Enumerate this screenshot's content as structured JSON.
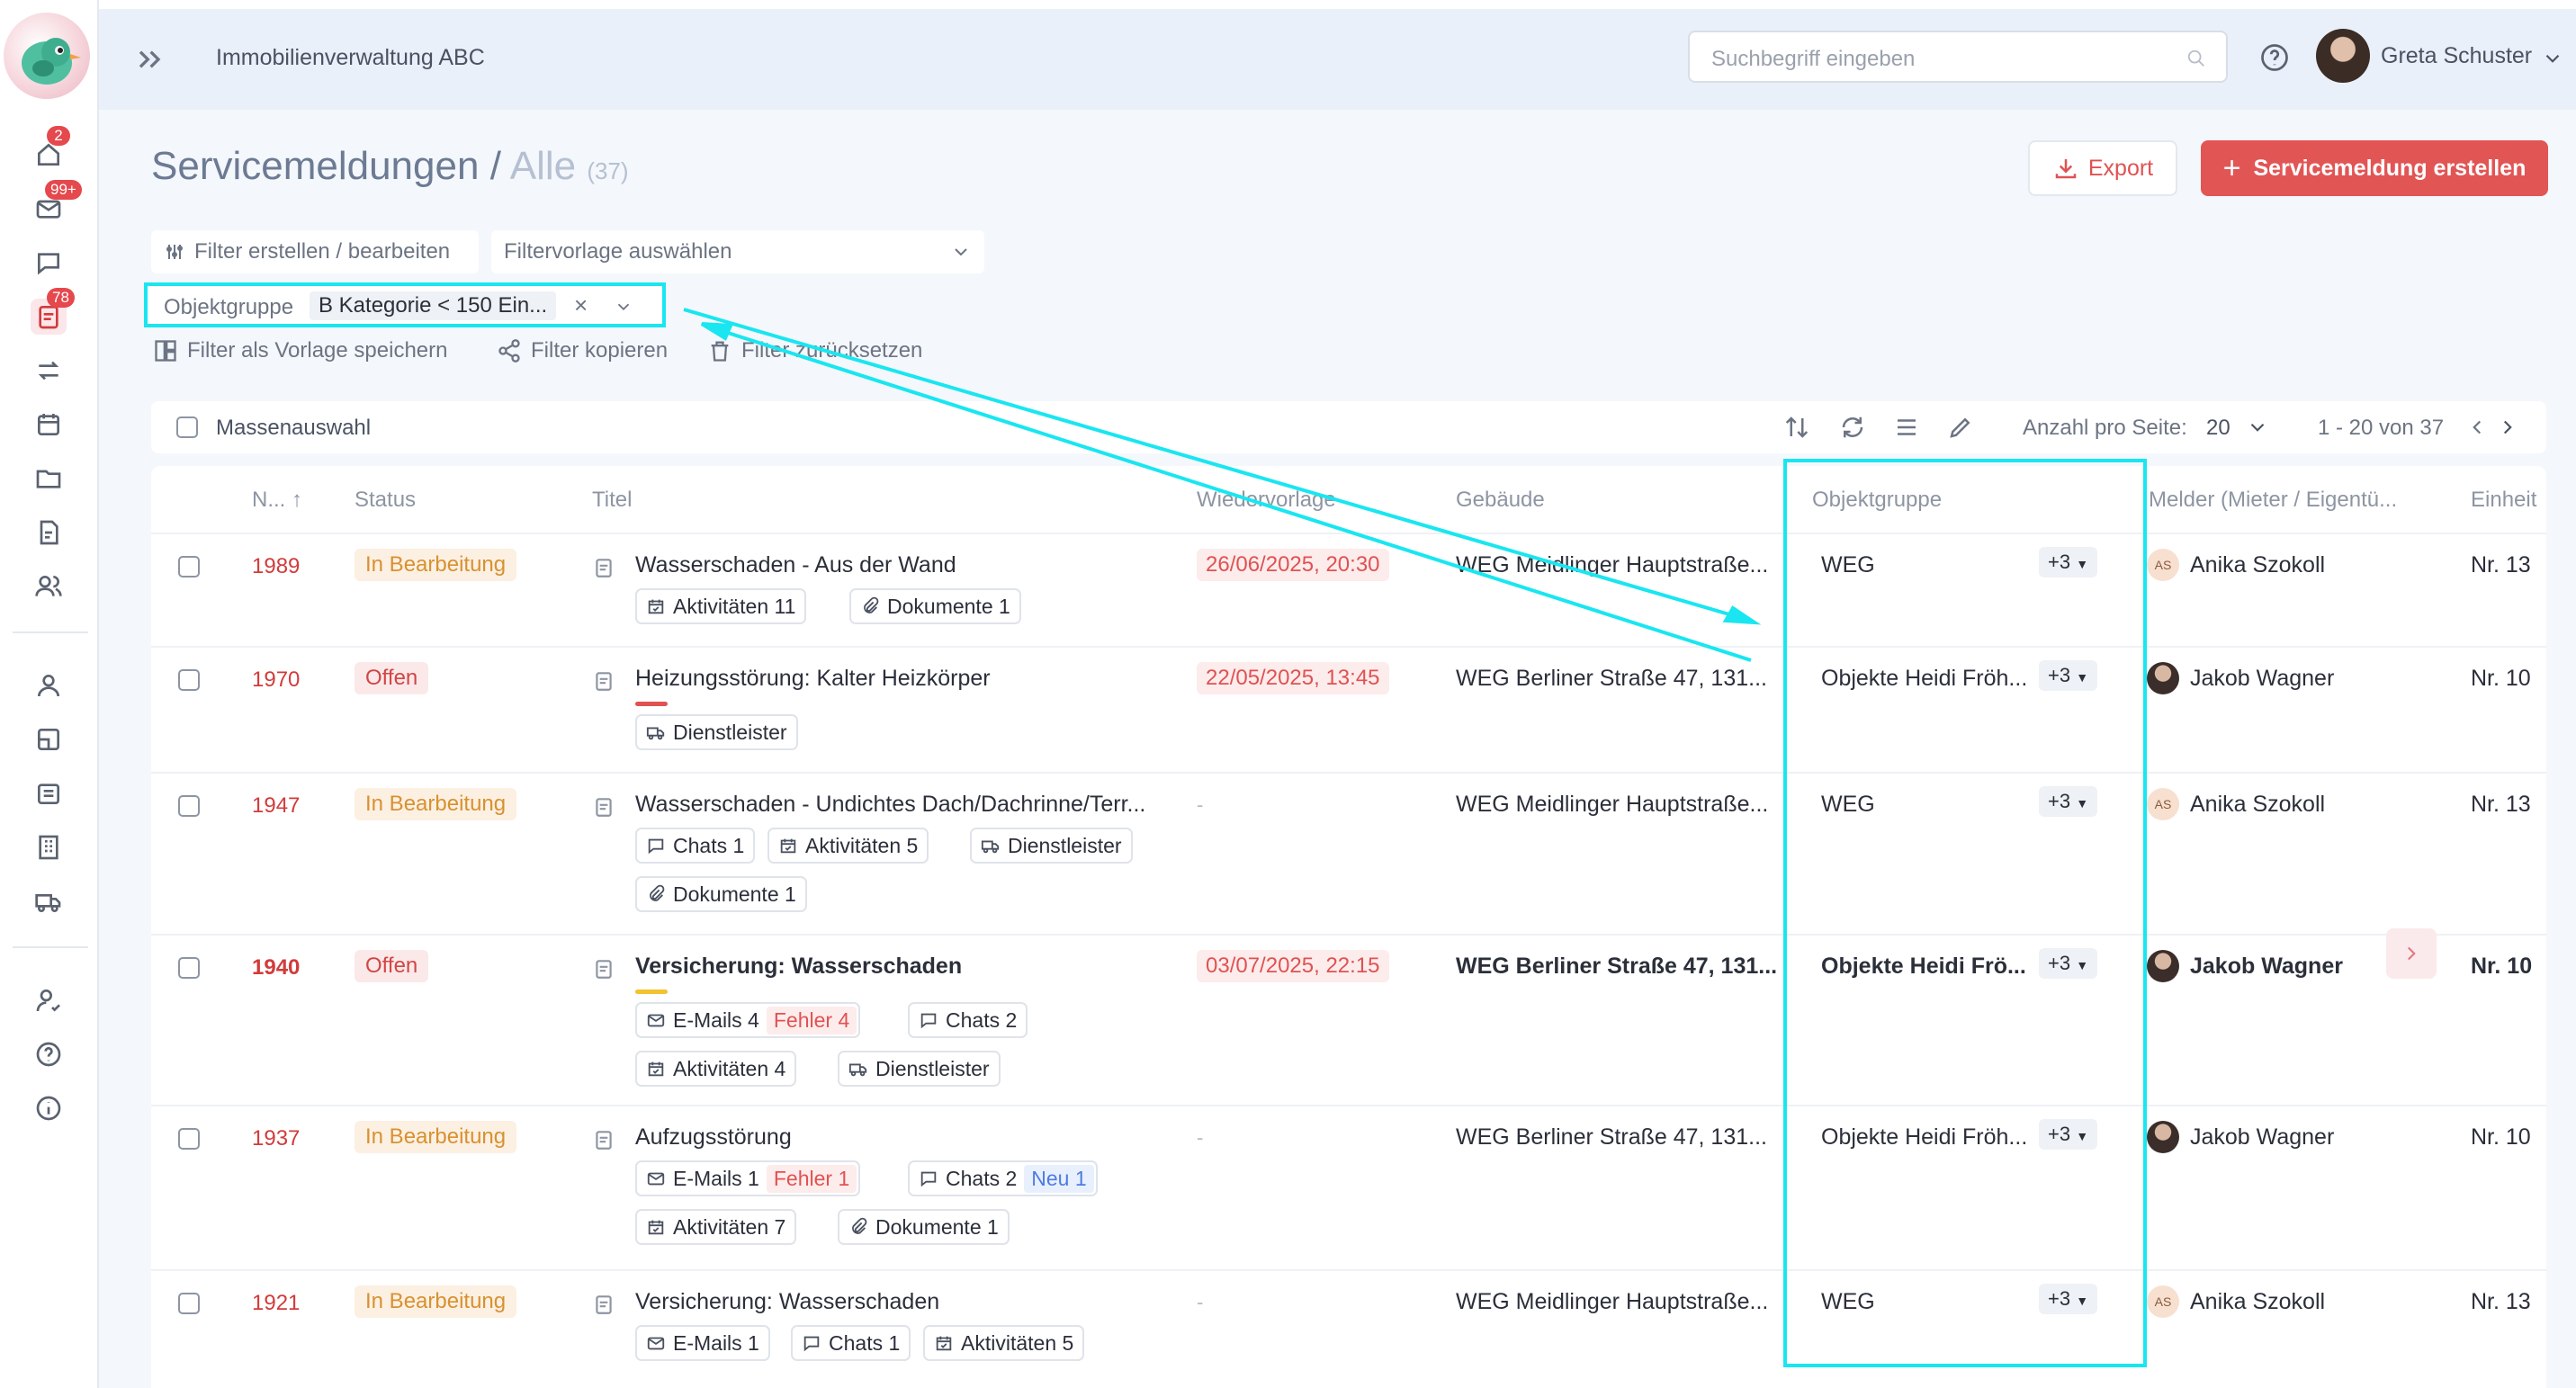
{
  "app": {
    "title": "Immobilienverwaltung ABC"
  },
  "search": {
    "placeholder": "Suchbegriff eingeben"
  },
  "user": {
    "name": "Greta Schuster"
  },
  "sidebar": {
    "badges": {
      "home": "2",
      "mail": "99+",
      "tickets": "78"
    }
  },
  "page": {
    "title": "Servicemeldungen",
    "separator": "/",
    "subtitle": "Alle",
    "count": "(37)"
  },
  "actions": {
    "export": "Export",
    "create": "Servicemeldung erstellen"
  },
  "filters": {
    "edit": "Filter erstellen / bearbeiten",
    "template_placeholder": "Filtervorlage auswählen",
    "chip_label": "Objektgruppe",
    "chip_value": "B Kategorie < 150 Ein...",
    "save_template": "Filter als Vorlage speichern",
    "copy": "Filter kopieren",
    "reset": "Filter zurücksetzen"
  },
  "toolbar": {
    "mass_select": "Massenauswahl",
    "per_page_label": "Anzahl pro Seite:",
    "per_page": "20",
    "range": "1 - 20 von 37"
  },
  "columns": {
    "number": "N... ↑",
    "status": "Status",
    "title": "Titel",
    "followup": "Wiedervorlage",
    "building": "Gebäude",
    "group": "Objektgruppe",
    "reporter": "Melder (Mieter / Eigentü...",
    "unit": "Einheit"
  },
  "rows": [
    {
      "number": "1989",
      "status": "In Bearbeitung",
      "title": "Wasserschaden - Aus der Wand",
      "followup": "26/06/2025, 20:30",
      "building": "WEG Meidlinger Hauptstraße...",
      "group": "WEG",
      "more": "+3",
      "reporter": "Anika Szokoll",
      "initials": "AS",
      "unit": "Nr. 13",
      "tags": [
        {
          "label": "Aktivitäten 11"
        },
        {
          "label": "Dokumente 1"
        }
      ]
    },
    {
      "number": "1970",
      "status": "Offen",
      "title": "Heizungsstörung: Kalter Heizkörper",
      "followup": "22/05/2025, 13:45",
      "building": "WEG Berliner Straße 47, 131...",
      "group": "Objekte Heidi Fröh...",
      "more": "+3",
      "reporter": "Jakob Wagner",
      "unit": "Nr. 10",
      "tags": [
        {
          "label": "Dienstleister"
        }
      ]
    },
    {
      "number": "1947",
      "status": "In Bearbeitung",
      "title": "Wasserschaden - Undichtes Dach/Dachrinne/Terr...",
      "followup": "-",
      "building": "WEG Meidlinger Hauptstraße...",
      "group": "WEG",
      "more": "+3",
      "reporter": "Anika Szokoll",
      "initials": "AS",
      "unit": "Nr. 13",
      "tags": [
        {
          "label": "Chats 1"
        },
        {
          "label": "Aktivitäten 5"
        },
        {
          "label": "Dienstleister"
        },
        {
          "label": "Dokumente 1"
        }
      ]
    },
    {
      "number": "1940",
      "status": "Offen",
      "title": "Versicherung: Wasserschaden",
      "followup": "03/07/2025, 22:15",
      "building": "WEG Berliner Straße 47, 131...",
      "group": "Objekte Heidi Frö...",
      "more": "+3",
      "reporter": "Jakob Wagner",
      "unit": "Nr. 10",
      "tags": [
        {
          "label": "E-Mails 4",
          "error": "Fehler 4"
        },
        {
          "label": "Chats 2"
        },
        {
          "label": "Aktivitäten 4"
        },
        {
          "label": "Dienstleister"
        }
      ]
    },
    {
      "number": "1937",
      "status": "In Bearbeitung",
      "title": "Aufzugsstörung",
      "followup": "-",
      "building": "WEG Berliner Straße 47, 131...",
      "group": "Objekte Heidi Fröh...",
      "more": "+3",
      "reporter": "Jakob Wagner",
      "unit": "Nr. 10",
      "tags": [
        {
          "label": "E-Mails 1",
          "error": "Fehler 1"
        },
        {
          "label": "Chats 2",
          "new": "Neu 1"
        },
        {
          "label": "Aktivitäten 7"
        },
        {
          "label": "Dokumente 1"
        }
      ]
    },
    {
      "number": "1921",
      "status": "In Bearbeitung",
      "title": "Versicherung: Wasserschaden",
      "followup": "-",
      "building": "WEG Meidlinger Hauptstraße...",
      "group": "WEG",
      "more": "+3",
      "reporter": "Anika Szokoll",
      "initials": "AS",
      "unit": "Nr. 13",
      "tags": [
        {
          "label": "E-Mails 1"
        },
        {
          "label": "Chats 1"
        },
        {
          "label": "Aktivitäten 5"
        }
      ]
    }
  ],
  "annotation_color": "#19e6f0"
}
